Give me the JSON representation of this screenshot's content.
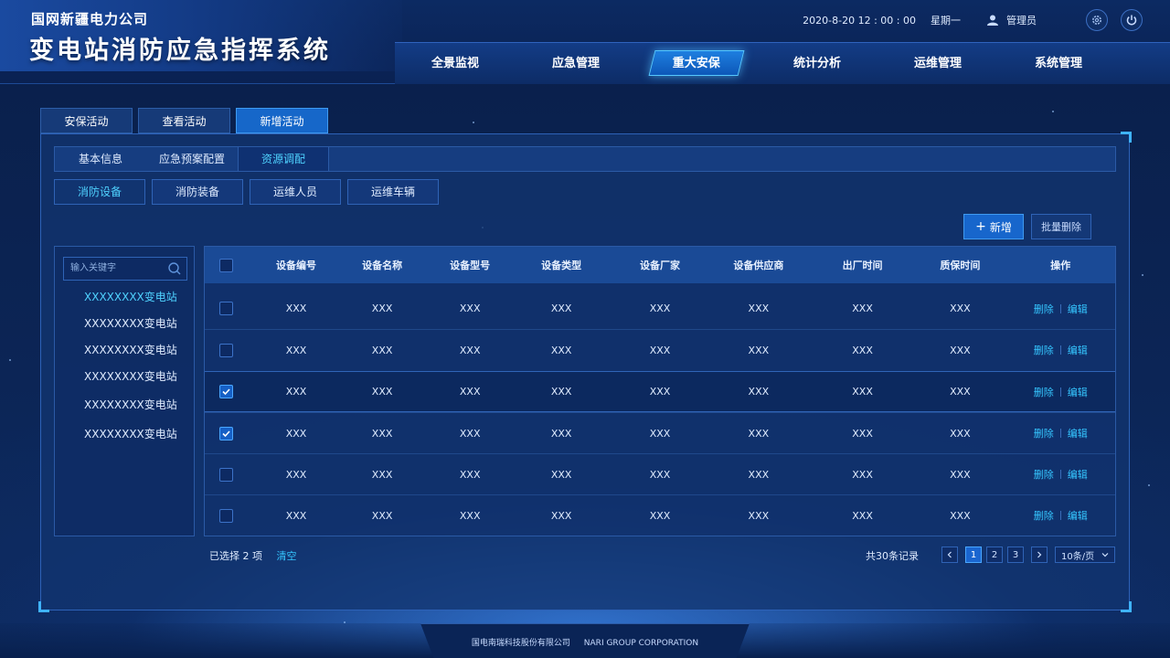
{
  "header": {
    "company": "国网新疆电力公司",
    "system_title": "变电站消防应急指挥系统",
    "datetime": "2020-8-20  12 : 00 : 00",
    "weekday": "星期一",
    "user": "管理员",
    "icons": [
      "user-icon",
      "gear-icon",
      "power-icon"
    ]
  },
  "nav": {
    "items": [
      {
        "label": "全景监视"
      },
      {
        "label": "应急管理"
      },
      {
        "label": "重大安保"
      },
      {
        "label": "统计分析"
      },
      {
        "label": "运维管理"
      },
      {
        "label": "系统管理"
      }
    ],
    "active": "重大安保"
  },
  "top_tabs": [
    {
      "label": "安保活动"
    },
    {
      "label": "查看活动"
    },
    {
      "label": "新增活动"
    }
  ],
  "sub_tabs": [
    {
      "label": "基本信息"
    },
    {
      "label": "应急预案配置"
    },
    {
      "label": "资源调配"
    }
  ],
  "res_tabs": [
    {
      "label": "消防设备"
    },
    {
      "label": "消防装备"
    },
    {
      "label": "运维人员"
    },
    {
      "label": "运维车辆"
    }
  ],
  "toolbar": {
    "add_label": "新增",
    "batch_delete_label": "批量删除"
  },
  "sidebar": {
    "search_placeholder": "输入关键字",
    "items": [
      {
        "label": "XXXXXXXX变电站"
      },
      {
        "label": "XXXXXXXX变电站"
      },
      {
        "label": "XXXXXXXX变电站"
      },
      {
        "label": "XXXXXXXX变电站"
      },
      {
        "label": "XXXXXXXX变电站"
      },
      {
        "label": "XXXXXXXX变电站"
      }
    ]
  },
  "table": {
    "columns": [
      "设备编号",
      "设备名称",
      "设备型号",
      "设备类型",
      "设备厂家",
      "设备供应商",
      "出厂时间",
      "质保时间",
      "操作"
    ],
    "rows": [
      {
        "checked": false,
        "cells": [
          "XXX",
          "XXX",
          "XXX",
          "XXX",
          "XXX",
          "XXX",
          "XXX",
          "XXX"
        ]
      },
      {
        "checked": false,
        "cells": [
          "XXX",
          "XXX",
          "XXX",
          "XXX",
          "XXX",
          "XXX",
          "XXX",
          "XXX"
        ]
      },
      {
        "checked": true,
        "cells": [
          "XXX",
          "XXX",
          "XXX",
          "XXX",
          "XXX",
          "XXX",
          "XXX",
          "XXX"
        ]
      },
      {
        "checked": true,
        "cells": [
          "XXX",
          "XXX",
          "XXX",
          "XXX",
          "XXX",
          "XXX",
          "XXX",
          "XXX"
        ]
      },
      {
        "checked": false,
        "cells": [
          "XXX",
          "XXX",
          "XXX",
          "XXX",
          "XXX",
          "XXX",
          "XXX",
          "XXX"
        ]
      },
      {
        "checked": false,
        "cells": [
          "XXX",
          "XXX",
          "XXX",
          "XXX",
          "XXX",
          "XXX",
          "XXX",
          "XXX"
        ]
      }
    ],
    "op_delete": "删除",
    "op_edit": "编辑"
  },
  "footer_bar": {
    "selected": "已选择 2 项",
    "clear": "清空",
    "total": "共30条记录",
    "pages": [
      "1",
      "2",
      "3"
    ],
    "current_page": "1",
    "page_size": "10条/页"
  },
  "footer": {
    "company_cn": "国电南瑞科技股份有限公司",
    "company_en": "NARI GROUP CORPORATION"
  },
  "colors": {
    "accent": "#35c6ff",
    "active_tab": "#1667c9",
    "background": "#0b2352"
  }
}
